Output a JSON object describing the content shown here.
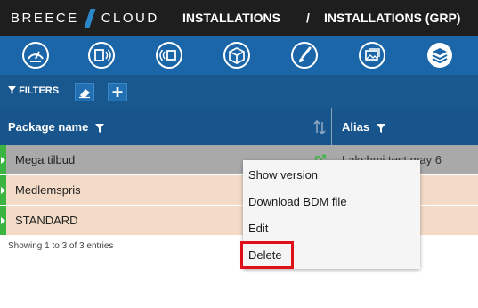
{
  "header": {
    "logo_left": "BREECE",
    "logo_right": "CLOUD",
    "breadcrumb": [
      "INSTALLATIONS",
      "/",
      "INSTALLATIONS (GRP)"
    ]
  },
  "toolbar": {
    "icons": [
      "dashboard-gauge-icon",
      "device-signal-icon",
      "broadcast-device-icon",
      "package-box-icon",
      "paint-brush-icon",
      "images-icon",
      "layers-stack-icon"
    ]
  },
  "filters": {
    "label": "FILTERS",
    "icons": [
      "funnel-icon",
      "eraser-icon",
      "plus-icon"
    ]
  },
  "table": {
    "columns": [
      "Package name",
      "Alias"
    ],
    "rows": [
      {
        "package": "Mega tilbud",
        "alias": "Lakshmi test may 6"
      },
      {
        "package": "Medlemspris",
        "alias": ""
      },
      {
        "package": "STANDARD",
        "alias": ""
      }
    ],
    "info": "Showing 1 to 3 of 3 entries"
  },
  "context_menu": {
    "items": [
      "Show version",
      "Download BDM file",
      "Edit",
      "Delete"
    ],
    "highlighted": "Delete",
    "highlight_color": "#e0101a"
  },
  "colors": {
    "topbar": "#1e1e1e",
    "toolbar": "#1a66a8",
    "header": "#17558c",
    "row_selected": "#a9a9a9",
    "row": "#f3dbc7",
    "status_green": "#3cb441"
  }
}
